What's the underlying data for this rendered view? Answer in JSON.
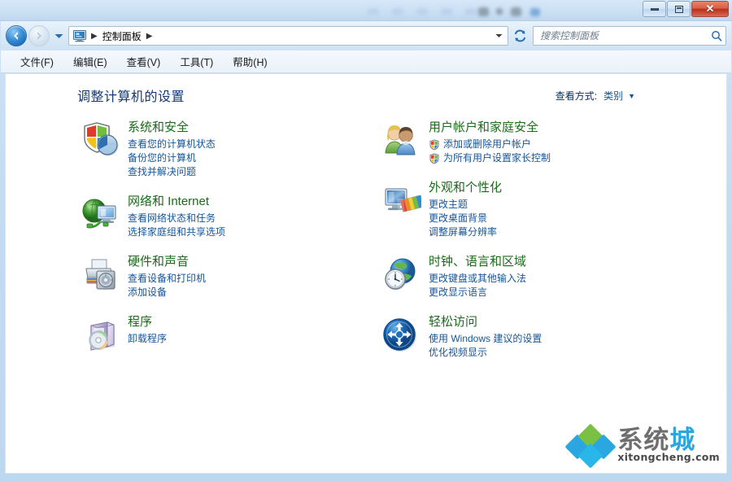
{
  "window": {
    "minimize_label": "",
    "restore_label": "",
    "close_label": "✕"
  },
  "nav": {
    "back_icon": "back-arrow-icon",
    "forward_icon": "forward-arrow-icon",
    "history_icon": "chevron-down-icon",
    "control_panel_icon": "control-panel-icon",
    "breadcrumb": "控制面板",
    "breadcrumb_sep": "▶",
    "dropdown_icon": "chevron-down-icon",
    "refresh_icon": "refresh-icon"
  },
  "search": {
    "placeholder": "搜索控制面板",
    "value": "",
    "icon": "search-icon"
  },
  "menu": {
    "items": [
      {
        "label": "文件(F)"
      },
      {
        "label": "编辑(E)"
      },
      {
        "label": "查看(V)"
      },
      {
        "label": "工具(T)"
      },
      {
        "label": "帮助(H)"
      }
    ]
  },
  "page": {
    "title": "调整计算机的设置"
  },
  "view_by": {
    "label": "查看方式:",
    "value": "类别",
    "arrow": "▼"
  },
  "categories": {
    "left": [
      {
        "icon": "security-shield-icon",
        "title": "系统和安全",
        "links": [
          {
            "text": "查看您的计算机状态",
            "shield": false
          },
          {
            "text": "备份您的计算机",
            "shield": false
          },
          {
            "text": "查找并解决问题",
            "shield": false
          }
        ]
      },
      {
        "icon": "network-globe-icon",
        "title": "网络和 Internet",
        "links": [
          {
            "text": "查看网络状态和任务",
            "shield": false
          },
          {
            "text": "选择家庭组和共享选项",
            "shield": false
          }
        ]
      },
      {
        "icon": "printer-sound-icon",
        "title": "硬件和声音",
        "links": [
          {
            "text": "查看设备和打印机",
            "shield": false
          },
          {
            "text": "添加设备",
            "shield": false
          }
        ]
      },
      {
        "icon": "programs-box-icon",
        "title": "程序",
        "links": [
          {
            "text": "卸载程序",
            "shield": false
          }
        ]
      }
    ],
    "right": [
      {
        "icon": "user-accounts-icon",
        "title": "用户帐户和家庭安全",
        "links": [
          {
            "text": "添加或删除用户帐户",
            "shield": true
          },
          {
            "text": "为所有用户设置家长控制",
            "shield": true
          }
        ]
      },
      {
        "icon": "appearance-monitor-icon",
        "title": "外观和个性化",
        "links": [
          {
            "text": "更改主题",
            "shield": false
          },
          {
            "text": "更改桌面背景",
            "shield": false
          },
          {
            "text": "调整屏幕分辨率",
            "shield": false
          }
        ]
      },
      {
        "icon": "clock-language-icon",
        "title": "时钟、语言和区域",
        "links": [
          {
            "text": "更改键盘或其他输入法",
            "shield": false
          },
          {
            "text": "更改显示语言",
            "shield": false
          }
        ]
      },
      {
        "icon": "ease-of-access-icon",
        "title": "轻松访问",
        "links": [
          {
            "text": "使用 Windows 建议的设置",
            "shield": false
          },
          {
            "text": "优化视频显示",
            "shield": false
          }
        ]
      }
    ]
  },
  "watermark": {
    "text_gray": "系统",
    "text_blue": "城",
    "url": "xitongcheng.com",
    "colors": [
      "#2aa7e0",
      "#7ac143",
      "#2aa7e0",
      "#29b6e8"
    ]
  },
  "colors": {
    "title_blue": "#123a77",
    "category_green": "#1b6b1b",
    "link_blue": "#15559a",
    "close_red": "#b7301c",
    "frame_blue": "#bcd7f0"
  }
}
